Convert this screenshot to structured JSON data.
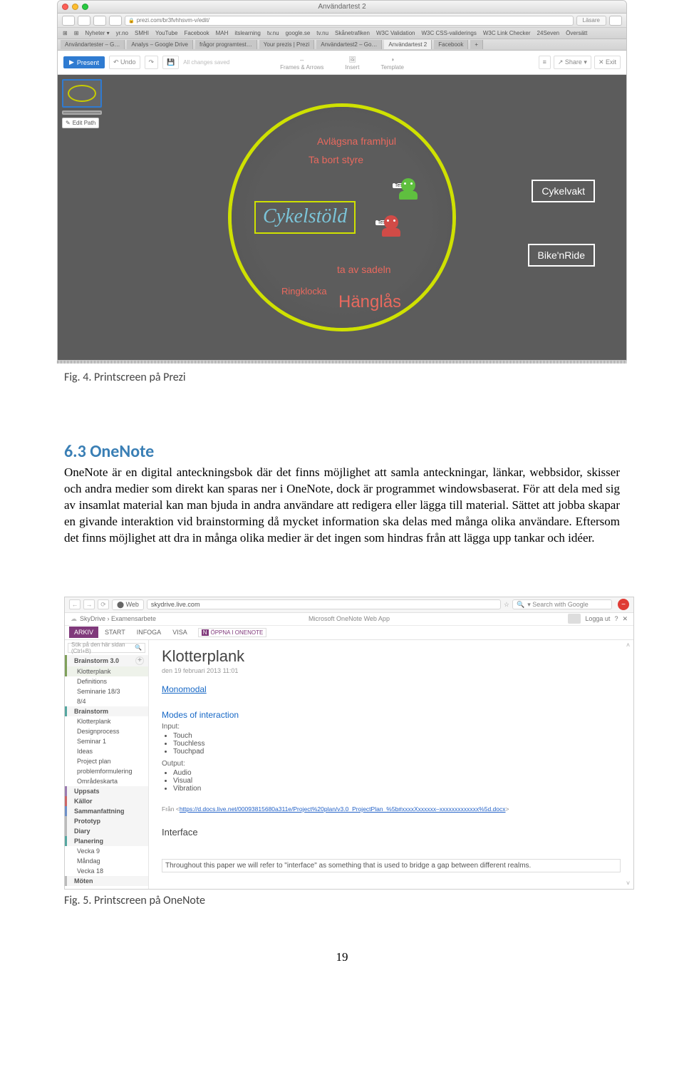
{
  "fig4": {
    "caption": "Fig. 4. Printscreen på Prezi",
    "browser": {
      "window_title": "Användartest 2",
      "address": "prezi.com/br3fvhhsvm-v/edit/",
      "reader_btn": "Läsare",
      "bookmarks": [
        "⊞",
        "⊞",
        "Nyheter ▾",
        "yr.no",
        "SMHI",
        "YouTube",
        "Facebook",
        "MAH",
        "itslearning",
        "tv.nu",
        "google.se",
        "tv.nu",
        "Skånetrafiken",
        "W3C Validation",
        "W3C CSS-validerings",
        "W3C Link Checker",
        "24Seven",
        "Översätt"
      ],
      "tabs": [
        "Användartester – G…",
        "Analys – Google Drive",
        "frågor programtest…",
        "Your prezis | Prezi",
        "Användartest2 – Go…",
        "Användartest 2",
        "Facebook"
      ]
    },
    "toolbar": {
      "present": "Present",
      "undo": "Undo",
      "saved": "All changes saved",
      "center": [
        {
          "icon": "↔",
          "label": "Frames & Arrows"
        },
        {
          "icon": "🖼",
          "label": "Insert"
        },
        {
          "icon": "◑",
          "label": "Template"
        }
      ],
      "right_menu": "≡",
      "share": "Share ▾",
      "exit": "Exit"
    },
    "sidebar": {
      "edit_path": "Edit Path"
    },
    "prezi": {
      "main_title": "Cykelstöld",
      "items": [
        "Avlägsna framhjul",
        "Ta bort styre",
        "ta av sadeln",
        "Ringklocka",
        "Hänglås"
      ],
      "green_label": "Test",
      "red_label": "Test",
      "side_boxes": [
        "Cykelvakt",
        "Bike'nRide"
      ]
    }
  },
  "section": {
    "number": "6.3",
    "title": "OneNote",
    "paragraph": "OneNote är en digital anteckningsbok där det finns möjlighet att samla anteckningar, länkar, webbsidor, skisser och andra medier som direkt kan sparas ner i OneNote, dock är programmet windowsbaserat. För att dela med sig av insamlat material kan man bjuda in andra användare att redigera eller lägga till material. Sättet att jobba skapar en givande interaktion vid brainstorming då mycket information ska delas med många olika användare. Eftersom det finns möjlighet att dra in många olika medier är det ingen som hindras från att lägga upp tankar och idéer."
  },
  "fig5": {
    "caption": "Fig. 5. Printscreen på OneNote",
    "browser": {
      "web_chip": "Web",
      "address": "skydrive.live.com",
      "search_prefix": "▾  Search with Google",
      "crumb": "SkyDrive  ›  Examensarbete",
      "center_title": "Microsoft OneNote Web App",
      "logout": "Logga ut",
      "help": "?"
    },
    "ribbon": {
      "tabs": [
        "ARKIV",
        "START",
        "INFOGA",
        "VISA"
      ],
      "open_in": "ÖPPNA I ONENOTE"
    },
    "sidebar_search": "Sök på den här sidan (Ctrl+B)",
    "notebook": [
      {
        "type": "section",
        "label": "Brainstorm 3.0",
        "class": "clr-green",
        "hasAdd": true
      },
      {
        "type": "page",
        "label": "Klotterplank",
        "class": "sel"
      },
      {
        "type": "page",
        "label": "Definitions"
      },
      {
        "type": "page",
        "label": "Seminarie 18/3"
      },
      {
        "type": "page",
        "label": "8/4"
      },
      {
        "type": "section",
        "label": "Brainstorm",
        "class": "clr-teal"
      },
      {
        "type": "page",
        "label": "Klotterplank"
      },
      {
        "type": "page",
        "label": "Designprocess"
      },
      {
        "type": "page",
        "label": "Seminar 1"
      },
      {
        "type": "page",
        "label": "Ideas"
      },
      {
        "type": "page",
        "label": "Project plan"
      },
      {
        "type": "page",
        "label": "problemformulering"
      },
      {
        "type": "page",
        "label": "Områdeskarta"
      },
      {
        "type": "section",
        "label": "Uppsats",
        "class": "clr-purple"
      },
      {
        "type": "section",
        "label": "Källor",
        "class": "clr-red"
      },
      {
        "type": "section",
        "label": "Sammanfattning",
        "class": "clr-blue"
      },
      {
        "type": "section",
        "label": "Prototyp",
        "class": "clr-gray"
      },
      {
        "type": "section",
        "label": "Diary",
        "class": "clr-gray"
      },
      {
        "type": "section",
        "label": "Planering",
        "class": "clr-teal"
      },
      {
        "type": "page",
        "label": "Vecka 9"
      },
      {
        "type": "page",
        "label": "Måndag"
      },
      {
        "type": "page",
        "label": "Vecka 18"
      },
      {
        "type": "section",
        "label": "Möten",
        "class": "clr-gray"
      }
    ],
    "content": {
      "title": "Klotterplank",
      "date": "den 19 februari 2013   11:01",
      "h_mono": "Monomodal",
      "h_modes": "Modes of interaction",
      "input_label": "Input:",
      "inputs": [
        "Touch",
        "Touchless",
        "Touchpad"
      ],
      "output_label": "Output:",
      "outputs": [
        "Audio",
        "Visual",
        "Vibration"
      ],
      "link_prefix": "Från <",
      "link": "https://d.docs.live.net/00093815680a311e/Project%20plan/v3.0_ProjectPlan_%5b#xxxxXxxxxxx–xxxxxxxxxxxxx%5d.docx",
      "link_suffix": ">",
      "h_interface": "Interface",
      "interface_p": "Throughout this paper we will refer to \"interface\" as something that is used to bridge a gap between different realms."
    }
  },
  "page_number": "19"
}
